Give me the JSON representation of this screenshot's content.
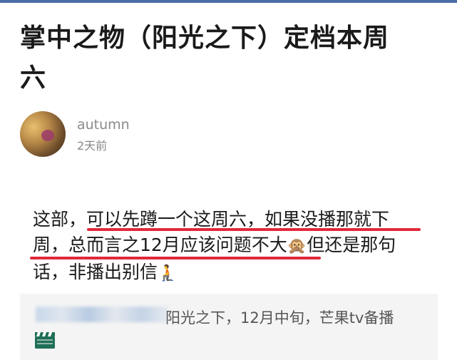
{
  "post": {
    "title_line1": "掌中之物（阳光之下）定档本周",
    "title_line2": "六"
  },
  "author": {
    "name": "autumn",
    "time": "2天前",
    "avatar_icon": "avatar-photo"
  },
  "content": {
    "line1_a": "这部，",
    "line1_b": "可以先蹲一个这周六，如果没播那就下",
    "line2_a": "周，总而言之12月应该问题不大",
    "line2_emoji": "🙊",
    "line2_b": "但还是那句",
    "line3_a": "话，非播出别信",
    "line3_emoji": "🧎",
    "underline_color": "#e0283a"
  },
  "quote": {
    "text": "阳光之下，12月中旬，芒果tv备播",
    "icon": "clapper-board-icon",
    "icon_color": "#1f6e57"
  }
}
